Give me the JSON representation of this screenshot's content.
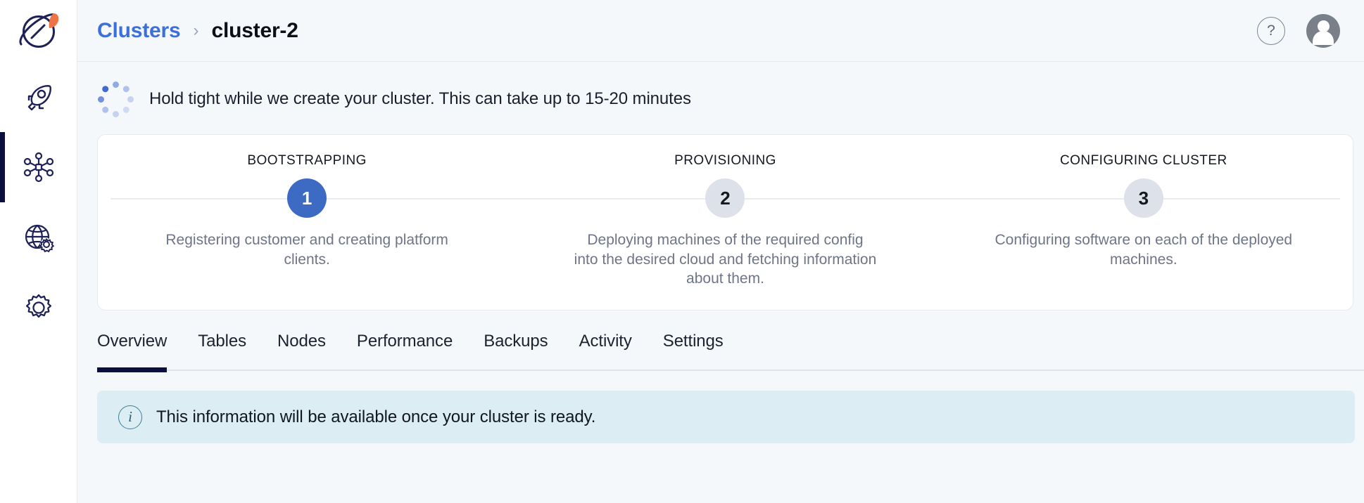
{
  "brand": {
    "logo_icon": "planet-rocket-logo",
    "navy": "#1e2157",
    "orange": "#ef7445"
  },
  "sidebar": {
    "items": [
      {
        "icon": "rocket-icon",
        "name": "deploy",
        "active": false
      },
      {
        "icon": "cluster-nodes-icon",
        "name": "clusters",
        "active": true
      },
      {
        "icon": "globe-settings-icon",
        "name": "network",
        "active": false
      },
      {
        "icon": "gear-icon",
        "name": "settings",
        "active": false
      }
    ]
  },
  "topbar": {
    "breadcrumb": {
      "parent": "Clusters",
      "separator": "›",
      "current": "cluster-2"
    },
    "help_icon": "question-mark-icon",
    "help_label": "?",
    "avatar_icon": "user-avatar-icon"
  },
  "status": {
    "spinner_icon": "loading-spinner-icon",
    "message": "Hold tight while we create your cluster. This can take up to 15-20 minutes"
  },
  "stepper": {
    "steps": [
      {
        "title": "BOOTSTRAPPING",
        "number": "1",
        "description": "Registering customer and creating platform clients.",
        "state": "active"
      },
      {
        "title": "PROVISIONING",
        "number": "2",
        "description": "Deploying machines of the required config into the desired cloud and fetching information about them.",
        "state": "idle"
      },
      {
        "title": "CONFIGURING CLUSTER",
        "number": "3",
        "description": "Configuring software on each of the deployed machines.",
        "state": "idle"
      }
    ],
    "active_color": "#3d6bc4",
    "idle_color": "#dde1e9"
  },
  "tabs": {
    "active_index": 0,
    "items": [
      {
        "label": "Overview"
      },
      {
        "label": "Tables"
      },
      {
        "label": "Nodes"
      },
      {
        "label": "Performance"
      },
      {
        "label": "Backups"
      },
      {
        "label": "Activity"
      },
      {
        "label": "Settings"
      }
    ],
    "indicator_color": "#0b0f3d"
  },
  "banner": {
    "icon": "info-icon",
    "icon_glyph": "i",
    "message": "This information will be available once your cluster is ready.",
    "background": "#dcedf4"
  }
}
